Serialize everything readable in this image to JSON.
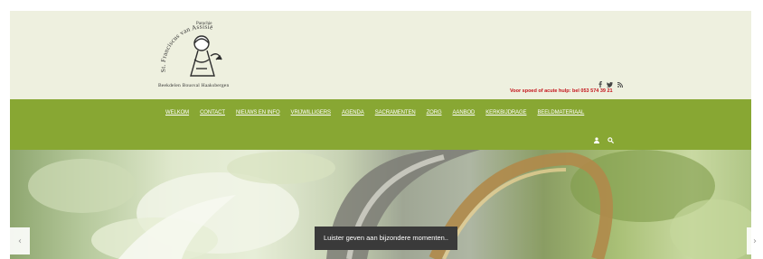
{
  "header": {
    "logo": {
      "parish_label": "Parochie",
      "arc_text": "St. Franciscus van Assisië",
      "caption": "Beekdelen   Bousval   Haaksbergen"
    },
    "social_icons": [
      "facebook-icon",
      "twitter-icon",
      "rss-icon"
    ],
    "emergency_text": "Voor spoed of acute hulp: bel 053 574 39 21"
  },
  "nav": {
    "items": [
      {
        "label": "WELKOM"
      },
      {
        "label": "CONTACT"
      },
      {
        "label": "NIEUWS EN INFO"
      },
      {
        "label": "VRIJWILLIGERS"
      },
      {
        "label": "AGENDA"
      },
      {
        "label": "SACRAMENTEN"
      },
      {
        "label": "ZORG"
      },
      {
        "label": "AANBOD"
      },
      {
        "label": "KERKBIJDRAGE"
      },
      {
        "label": "BEELDMATERIAAL"
      }
    ],
    "icons": [
      "user-icon",
      "search-icon"
    ]
  },
  "hero": {
    "caption": "Luister geven aan bijzondere momenten..",
    "prev_arrow": "‹",
    "next_arrow": "›"
  },
  "colors": {
    "header_bg": "#eef0df",
    "nav_bg": "#88a733",
    "emergency": "#c4141b",
    "caption_bg": "#3a3a3a"
  }
}
